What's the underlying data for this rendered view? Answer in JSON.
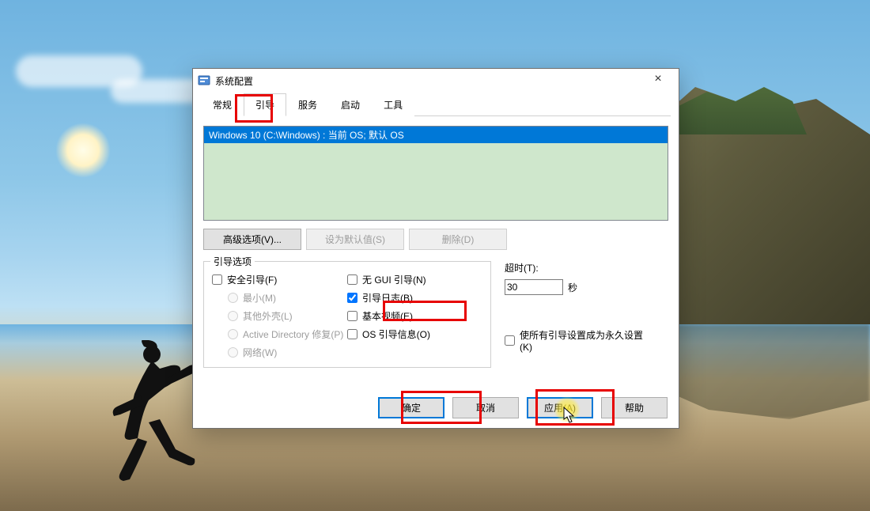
{
  "window": {
    "title": "系统配置",
    "close_glyph": "×"
  },
  "tabs": {
    "general": "常规",
    "boot": "引导",
    "services": "服务",
    "startup": "启动",
    "tools": "工具"
  },
  "os_list": {
    "items": [
      "Windows 10 (C:\\Windows) : 当前 OS; 默认 OS"
    ]
  },
  "buttons": {
    "advanced": "高级选项(V)...",
    "set_default": "设为默认值(S)",
    "delete": "删除(D)"
  },
  "boot_options": {
    "legend": "引导选项",
    "safe_boot": "安全引导(F)",
    "minimal": "最小(M)",
    "altshell": "其他外壳(L)",
    "adrepair": "Active Directory 修复(P)",
    "network": "网络(W)",
    "no_gui": "无 GUI 引导(N)",
    "boot_log": "引导日志(B)",
    "base_video": "基本视频(E)",
    "os_boot_info": "OS 引导信息(O)"
  },
  "timeout": {
    "label": "超时(T):",
    "value": "30",
    "unit": "秒"
  },
  "permanent": {
    "label": "使所有引导设置成为永久设置(K)"
  },
  "dialog_buttons": {
    "ok": "确定",
    "cancel": "取消",
    "apply": "应用(A)",
    "help": "帮助"
  }
}
